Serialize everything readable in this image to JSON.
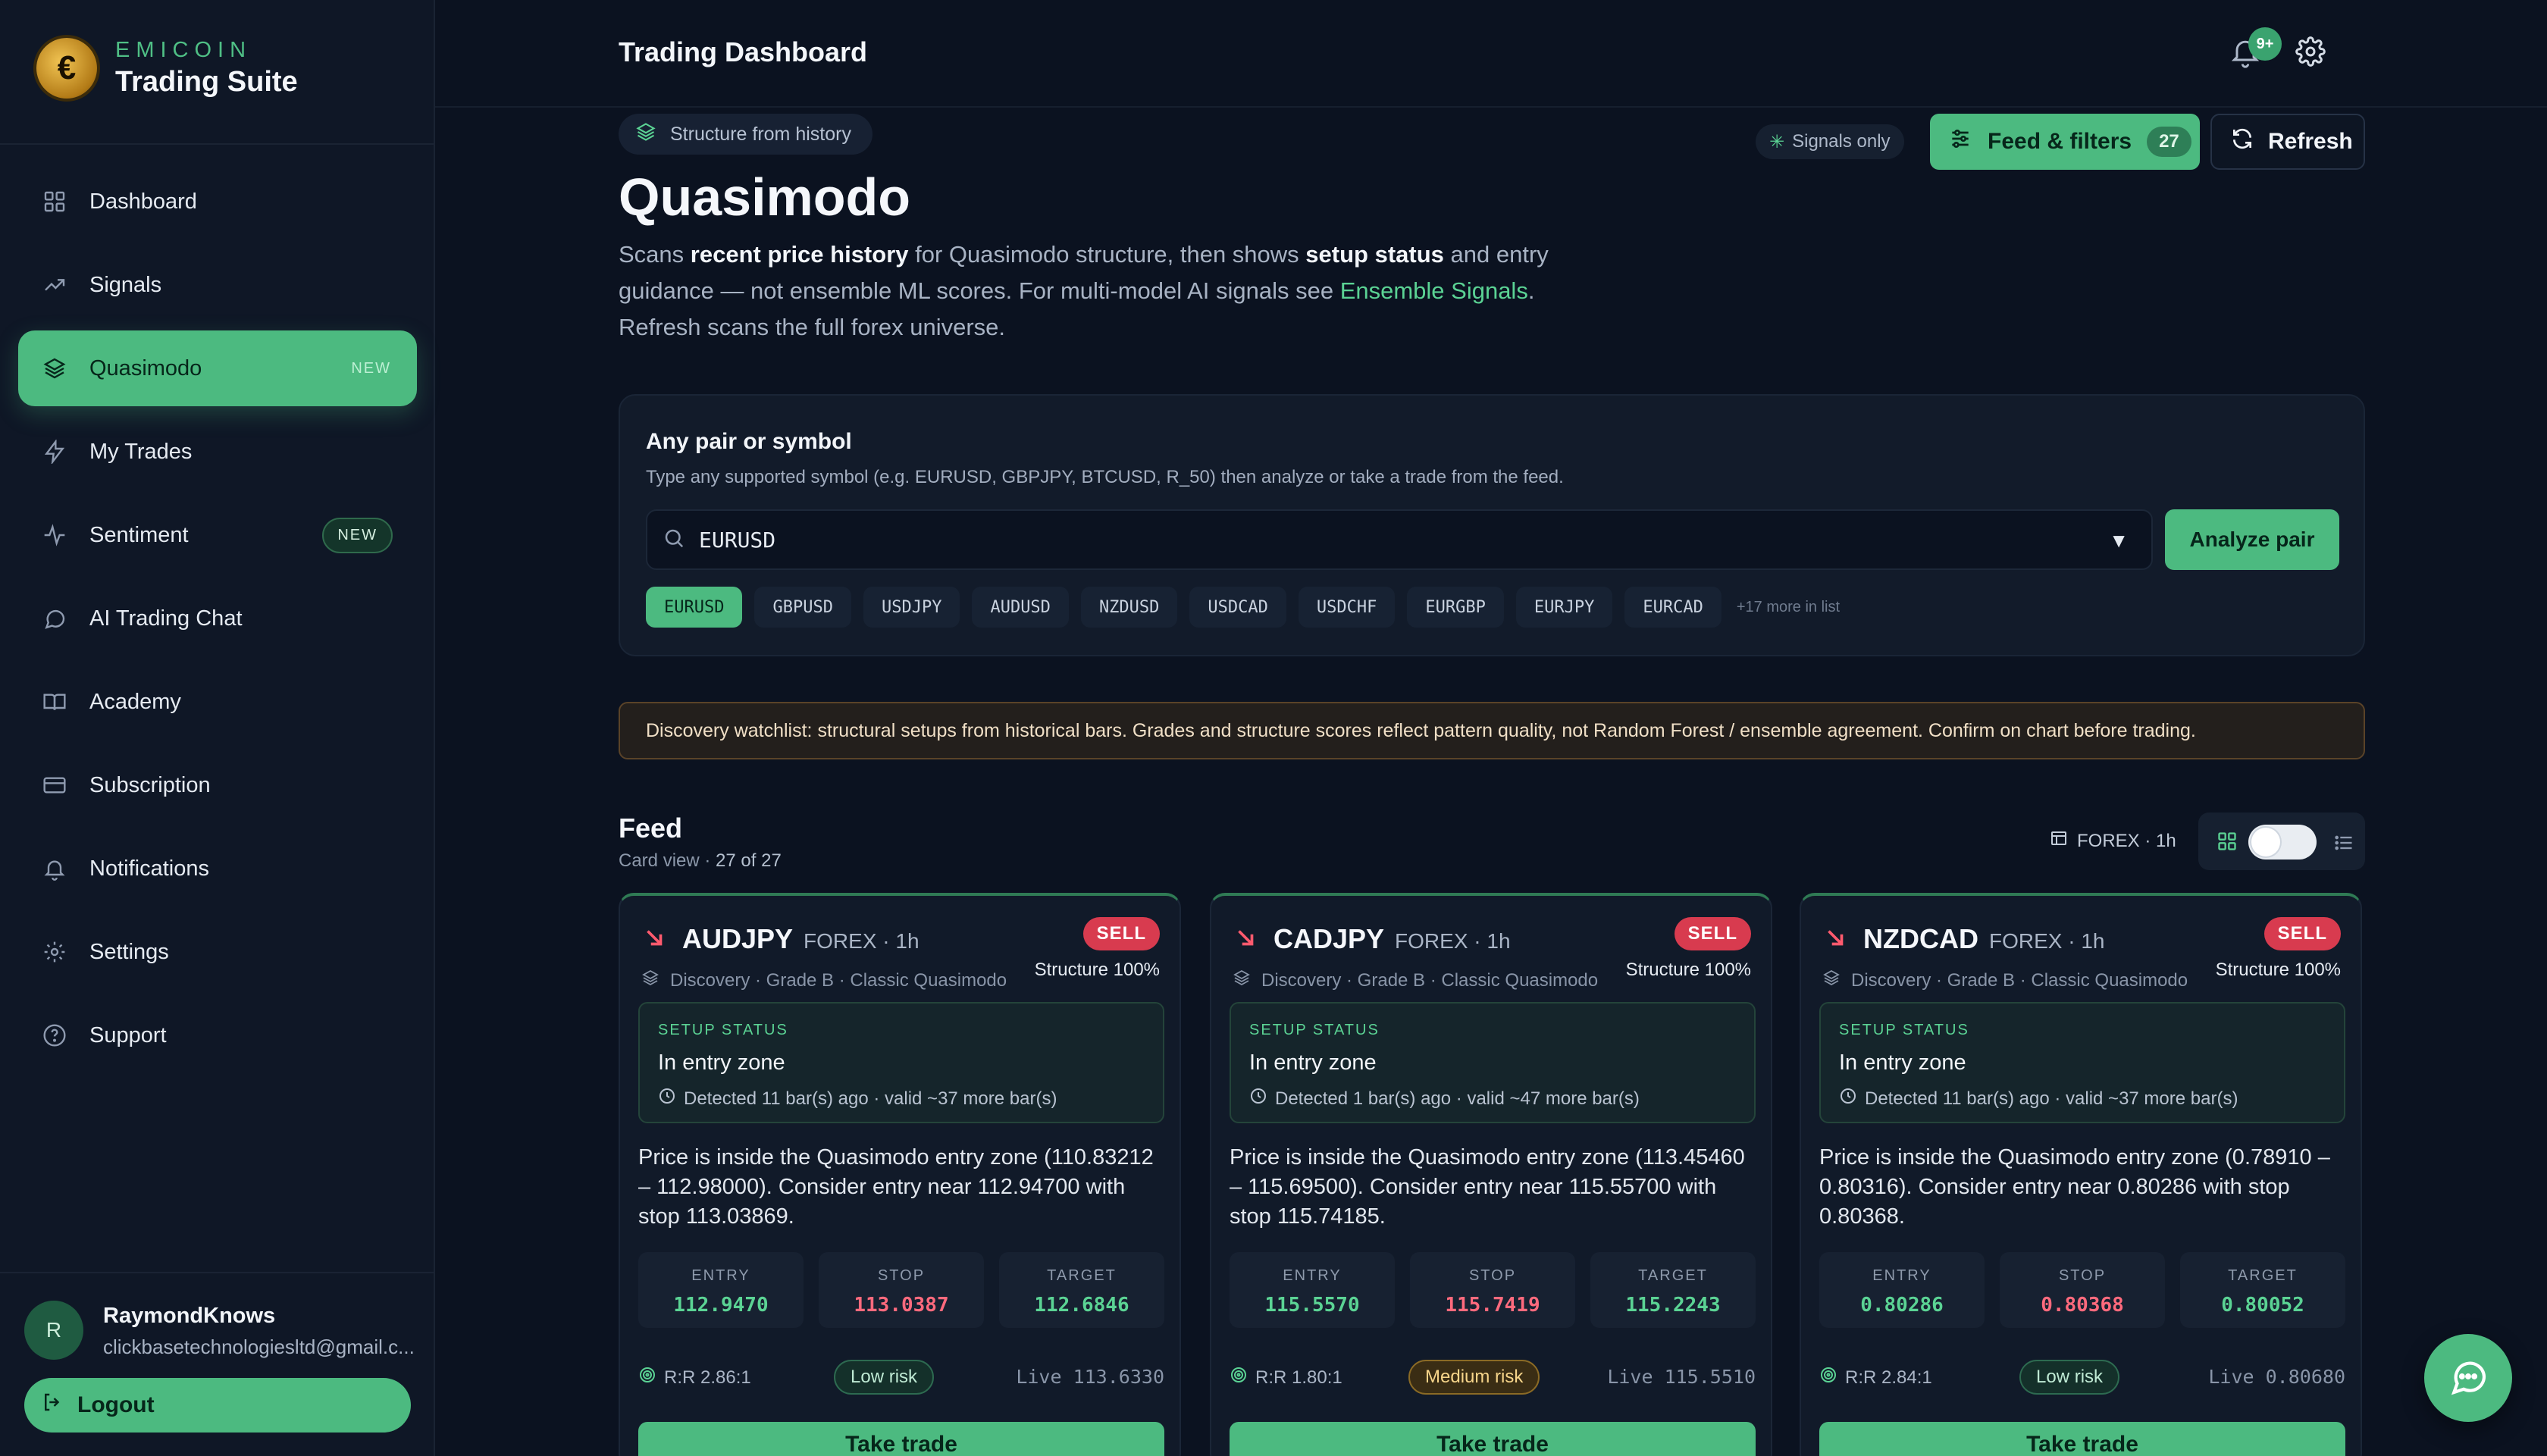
{
  "brand": {
    "sub": "EMICOIN",
    "title": "Trading Suite",
    "logo_glyph": "€"
  },
  "sidebar": {
    "items": [
      {
        "label": "Dashboard",
        "icon": "grid-icon"
      },
      {
        "label": "Signals",
        "icon": "trending-up-icon"
      },
      {
        "label": "Quasimodo",
        "icon": "layers-icon",
        "badge": "NEW",
        "active": true
      },
      {
        "label": "My Trades",
        "icon": "bolt-icon"
      },
      {
        "label": "Sentiment",
        "icon": "pulse-icon",
        "badge": "NEW"
      },
      {
        "label": "AI Trading Chat",
        "icon": "chat-bubble-icon"
      },
      {
        "label": "Academy",
        "icon": "book-icon"
      },
      {
        "label": "Subscription",
        "icon": "credit-card-icon"
      },
      {
        "label": "Notifications",
        "icon": "bell-icon"
      },
      {
        "label": "Settings",
        "icon": "gear-icon"
      },
      {
        "label": "Support",
        "icon": "help-circle-icon"
      }
    ],
    "user": {
      "initial": "R",
      "name": "RaymondKnows",
      "email": "clickbasetechnologiesltd@gmail.c..."
    },
    "logout_label": "Logout"
  },
  "topbar": {
    "title": "Trading Dashboard",
    "notification_badge": "9+"
  },
  "hero": {
    "chip": "Structure from history",
    "title": "Quasimodo",
    "desc_1": "Scans ",
    "desc_b1": "recent price history",
    "desc_2": " for Quasimodo structure, then shows ",
    "desc_b2": "setup status",
    "desc_3": " and entry guidance — not ensemble ML scores. For multi-model AI signals see ",
    "desc_link": "Ensemble Signals",
    "desc_4": ". Refresh scans the full forex universe."
  },
  "actions": {
    "signals_only": "Signals only",
    "feed_filters": "Feed & filters",
    "feed_count": "27",
    "refresh": "Refresh"
  },
  "pair_panel": {
    "title": "Any pair or symbol",
    "help": "Type any supported symbol (e.g. EURUSD, GBPJPY, BTCUSD, R_50) then analyze or take a trade from the feed.",
    "value": "EURUSD",
    "analyze": "Analyze pair",
    "chips": [
      "EURUSD",
      "GBPUSD",
      "USDJPY",
      "AUDUSD",
      "NZDUSD",
      "USDCAD",
      "USDCHF",
      "EURGBP",
      "EURJPY",
      "EURCAD"
    ],
    "selected": "EURUSD",
    "more": "+17 more in list"
  },
  "notice": "Discovery watchlist: structural setups from historical bars. Grades and structure scores reflect pattern quality, not Random Forest / ensemble agreement. Confirm on chart before trading.",
  "feed": {
    "title": "Feed",
    "view": "Card view",
    "sep": "·",
    "count": "27 of 27",
    "scope": "FOREX · 1h"
  },
  "cards": [
    {
      "pair": "AUDJPY",
      "tf": "FOREX · 1h",
      "side": "SELL",
      "meta": "Discovery · Grade B · Classic Quasimodo",
      "structure": "Structure 100%",
      "setup_label": "SETUP STATUS",
      "setup_value": "In entry zone",
      "detected": "Detected 11 bar(s) ago · valid ~37 more bar(s)",
      "guidance": "Price is inside the Quasimodo entry zone (110.83212 – 112.98000). Consider entry near 112.94700 with stop 113.03869.",
      "entry_label": "ENTRY",
      "entry": "112.9470",
      "stop_label": "STOP",
      "stop": "113.0387",
      "target_label": "TARGET",
      "target": "112.6846",
      "rr": "R:R 2.86:1",
      "risk": "Low risk",
      "risk_level": "low",
      "live": "Live 113.6330",
      "cta": "Take trade"
    },
    {
      "pair": "CADJPY",
      "tf": "FOREX · 1h",
      "side": "SELL",
      "meta": "Discovery · Grade B · Classic Quasimodo",
      "structure": "Structure 100%",
      "setup_label": "SETUP STATUS",
      "setup_value": "In entry zone",
      "detected": "Detected 1 bar(s) ago · valid ~47 more bar(s)",
      "guidance": "Price is inside the Quasimodo entry zone (113.45460 – 115.69500). Consider entry near 115.55700 with stop 115.74185.",
      "entry_label": "ENTRY",
      "entry": "115.5570",
      "stop_label": "STOP",
      "stop": "115.7419",
      "target_label": "TARGET",
      "target": "115.2243",
      "rr": "R:R 1.80:1",
      "risk": "Medium risk",
      "risk_level": "medium",
      "live": "Live 115.5510",
      "cta": "Take trade"
    },
    {
      "pair": "NZDCAD",
      "tf": "FOREX · 1h",
      "side": "SELL",
      "meta": "Discovery · Grade B · Classic Quasimodo",
      "structure": "Structure 100%",
      "setup_label": "SETUP STATUS",
      "setup_value": "In entry zone",
      "detected": "Detected 11 bar(s) ago · valid ~37 more bar(s)",
      "guidance": "Price is inside the Quasimodo entry zone (0.78910 – 0.80316). Consider entry near 0.80286 with stop 0.80368.",
      "entry_label": "ENTRY",
      "entry": "0.80286",
      "stop_label": "STOP",
      "stop": "0.80368",
      "target_label": "TARGET",
      "target": "0.80052",
      "rr": "R:R 2.84:1",
      "risk": "Low risk",
      "risk_level": "low",
      "live": "Live 0.80680",
      "cta": "Take trade"
    }
  ],
  "colors": {
    "accent": "#4cba80",
    "sell": "#d83b4f",
    "background": "#0b1220",
    "panel": "#121b2a"
  }
}
